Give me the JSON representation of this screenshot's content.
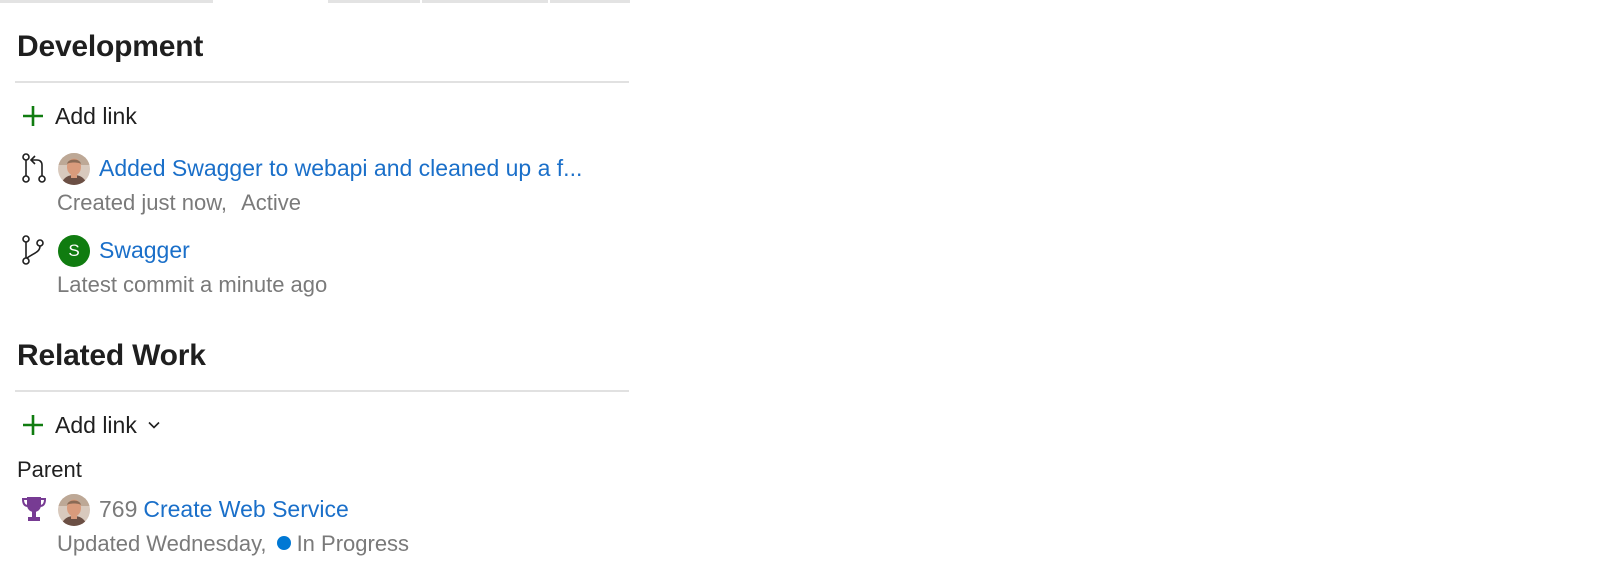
{
  "colors": {
    "link": "#1a6fc9",
    "plus": "#107c10",
    "secondary_text": "#7a7a7a",
    "status_in_progress": "#0078d4",
    "trophy": "#773b93",
    "avatar_letter_bg": "#107c10"
  },
  "development": {
    "title": "Development",
    "add_link_label": "Add link",
    "pull_request": {
      "icon": "pull-request-icon",
      "title": "Added Swagger to webapi and cleaned up a f...",
      "created": "Created just now,",
      "status": "Active"
    },
    "branch": {
      "icon": "branch-icon",
      "avatar_letter": "S",
      "name": "Swagger",
      "meta": "Latest commit a minute ago"
    }
  },
  "related_work": {
    "title": "Related Work",
    "add_link_label": "Add link",
    "group_label": "Parent",
    "parent": {
      "icon": "trophy-icon",
      "id": "769",
      "title": "Create Web Service",
      "updated": "Updated Wednesday,",
      "state": "In Progress"
    }
  }
}
